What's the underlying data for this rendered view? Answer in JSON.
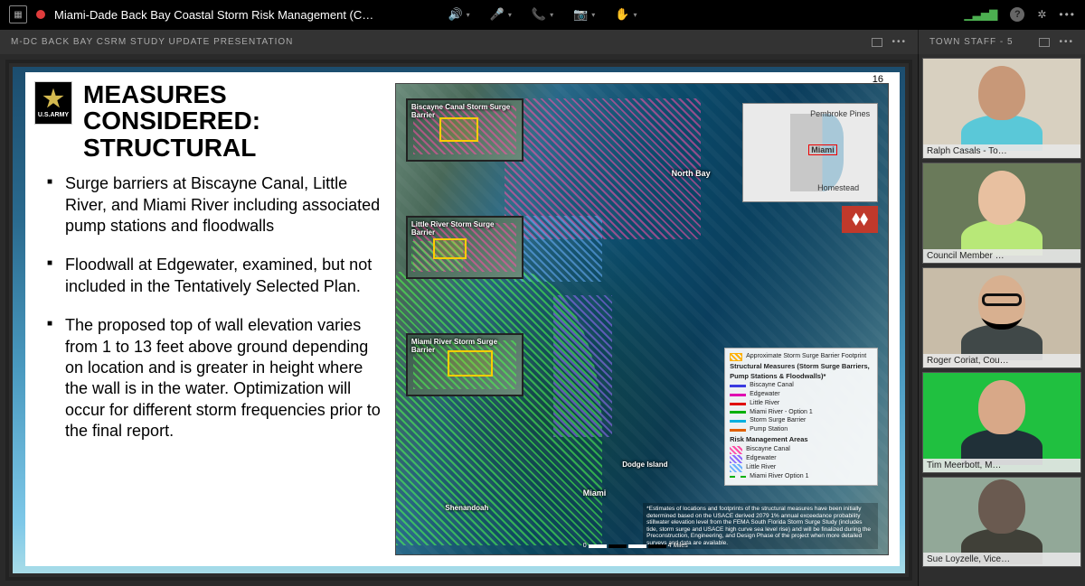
{
  "topbar": {
    "meeting_title": "Miami-Dade Back Bay Coastal Storm Risk Management (C…"
  },
  "panels": {
    "main_title": "M-DC BACK BAY CSRM STUDY UPDATE PRESENTATION",
    "side_title": "TOWN STAFF - 5"
  },
  "slide": {
    "page_number": "16",
    "army_label": "U.S.ARMY",
    "title_l1": "MEASURES",
    "title_l2": "CONSIDERED:",
    "title_l3": "STRUCTURAL",
    "bullets": [
      "Surge barriers at Biscayne Canal, Little River, and Miami River including associated pump stations and floodwalls",
      "Floodwall at Edgewater, examined, but not included in the Tentatively Selected Plan.",
      "The proposed top of wall elevation varies from 1 to 13 feet above ground depending on location and is greater in height where the wall is in the water. Optimization will occur for different storm frequencies prior to the final report."
    ],
    "thumbs": [
      "Biscayne Canal  Storm Surge Barrier",
      "Little River  Storm Surge Barrier",
      "Miami River Storm Surge Barrier"
    ],
    "map_labels": {
      "miami": "Miami",
      "northbay": "North Bay",
      "dodge": "Dodge Island",
      "shenandoah": "Shenandoah"
    },
    "locator": {
      "pp": "Pembroke Pines",
      "miami": "Miami",
      "homestead": "Homestead"
    },
    "legend": {
      "approx": "Approximate Storm Surge Barrier Footprint",
      "struct_title": "Structural Measures (Storm Surge Barriers, Pump Stations & Floodwalls)*",
      "items_struct": [
        "Biscayne Canal",
        "Edgewater",
        "Little River",
        "Miami River - Option 1",
        "Storm Surge Barrier",
        "Pump Station"
      ],
      "risk_title": "Risk Management Areas",
      "items_risk": [
        "Biscayne Canal",
        "Edgewater",
        "Little River",
        "Miami River Option 1"
      ]
    },
    "disclaimer": "*Estimates of locations and footprints of the structural measures have been initially determined based on the USACE derived 2079 1% annual exceedance probability stillwater elevation level from the FEMA South Florida Storm Surge Study (includes tide, storm surge and USACE high curve sea level rise) and will be finalized during the Preconstruction, Engineering, and Design Phase of the project when more detailed surveys and data are available.",
    "scale_end": "4 Miles"
  },
  "participants": [
    {
      "name": "Ralph Casals - To…",
      "bg": "#d8d0c0",
      "skin": "#c89878",
      "shirt": "#5ac8d8"
    },
    {
      "name": "Council Member …",
      "bg": "#6a7a5a",
      "skin": "#e8c0a0",
      "shirt": "#b8e878"
    },
    {
      "name": "Roger Coriat, Cou…",
      "bg": "#c8bca8",
      "skin": "#d8b090",
      "shirt": "#404848",
      "glasses": true
    },
    {
      "name": "Tim Meerbott, M…",
      "bg": "#20c040",
      "skin": "#d8a888",
      "shirt": "#203038"
    },
    {
      "name": "Sue Loyzelle, Vice…",
      "bg": "#92a898",
      "skin": "#6a5a50",
      "shirt": "#404038"
    }
  ]
}
